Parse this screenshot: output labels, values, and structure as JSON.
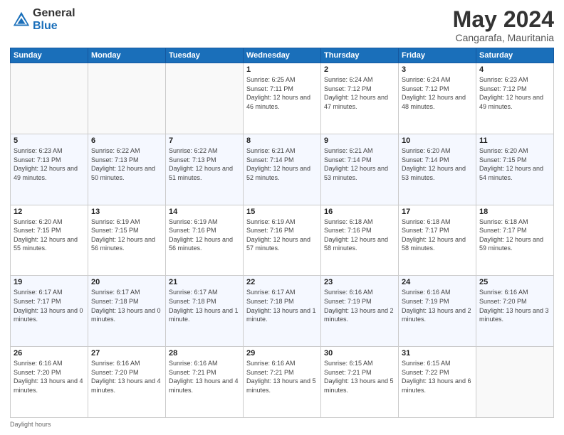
{
  "logo": {
    "general": "General",
    "blue": "Blue"
  },
  "title": "May 2024",
  "location": "Cangarafa, Mauritania",
  "headers": [
    "Sunday",
    "Monday",
    "Tuesday",
    "Wednesday",
    "Thursday",
    "Friday",
    "Saturday"
  ],
  "weeks": [
    [
      {
        "day": "",
        "sunrise": "",
        "sunset": "",
        "daylight": ""
      },
      {
        "day": "",
        "sunrise": "",
        "sunset": "",
        "daylight": ""
      },
      {
        "day": "",
        "sunrise": "",
        "sunset": "",
        "daylight": ""
      },
      {
        "day": "1",
        "sunrise": "Sunrise: 6:25 AM",
        "sunset": "Sunset: 7:11 PM",
        "daylight": "Daylight: 12 hours and 46 minutes."
      },
      {
        "day": "2",
        "sunrise": "Sunrise: 6:24 AM",
        "sunset": "Sunset: 7:12 PM",
        "daylight": "Daylight: 12 hours and 47 minutes."
      },
      {
        "day": "3",
        "sunrise": "Sunrise: 6:24 AM",
        "sunset": "Sunset: 7:12 PM",
        "daylight": "Daylight: 12 hours and 48 minutes."
      },
      {
        "day": "4",
        "sunrise": "Sunrise: 6:23 AM",
        "sunset": "Sunset: 7:12 PM",
        "daylight": "Daylight: 12 hours and 49 minutes."
      }
    ],
    [
      {
        "day": "5",
        "sunrise": "Sunrise: 6:23 AM",
        "sunset": "Sunset: 7:13 PM",
        "daylight": "Daylight: 12 hours and 49 minutes."
      },
      {
        "day": "6",
        "sunrise": "Sunrise: 6:22 AM",
        "sunset": "Sunset: 7:13 PM",
        "daylight": "Daylight: 12 hours and 50 minutes."
      },
      {
        "day": "7",
        "sunrise": "Sunrise: 6:22 AM",
        "sunset": "Sunset: 7:13 PM",
        "daylight": "Daylight: 12 hours and 51 minutes."
      },
      {
        "day": "8",
        "sunrise": "Sunrise: 6:21 AM",
        "sunset": "Sunset: 7:14 PM",
        "daylight": "Daylight: 12 hours and 52 minutes."
      },
      {
        "day": "9",
        "sunrise": "Sunrise: 6:21 AM",
        "sunset": "Sunset: 7:14 PM",
        "daylight": "Daylight: 12 hours and 53 minutes."
      },
      {
        "day": "10",
        "sunrise": "Sunrise: 6:20 AM",
        "sunset": "Sunset: 7:14 PM",
        "daylight": "Daylight: 12 hours and 53 minutes."
      },
      {
        "day": "11",
        "sunrise": "Sunrise: 6:20 AM",
        "sunset": "Sunset: 7:15 PM",
        "daylight": "Daylight: 12 hours and 54 minutes."
      }
    ],
    [
      {
        "day": "12",
        "sunrise": "Sunrise: 6:20 AM",
        "sunset": "Sunset: 7:15 PM",
        "daylight": "Daylight: 12 hours and 55 minutes."
      },
      {
        "day": "13",
        "sunrise": "Sunrise: 6:19 AM",
        "sunset": "Sunset: 7:15 PM",
        "daylight": "Daylight: 12 hours and 56 minutes."
      },
      {
        "day": "14",
        "sunrise": "Sunrise: 6:19 AM",
        "sunset": "Sunset: 7:16 PM",
        "daylight": "Daylight: 12 hours and 56 minutes."
      },
      {
        "day": "15",
        "sunrise": "Sunrise: 6:19 AM",
        "sunset": "Sunset: 7:16 PM",
        "daylight": "Daylight: 12 hours and 57 minutes."
      },
      {
        "day": "16",
        "sunrise": "Sunrise: 6:18 AM",
        "sunset": "Sunset: 7:16 PM",
        "daylight": "Daylight: 12 hours and 58 minutes."
      },
      {
        "day": "17",
        "sunrise": "Sunrise: 6:18 AM",
        "sunset": "Sunset: 7:17 PM",
        "daylight": "Daylight: 12 hours and 58 minutes."
      },
      {
        "day": "18",
        "sunrise": "Sunrise: 6:18 AM",
        "sunset": "Sunset: 7:17 PM",
        "daylight": "Daylight: 12 hours and 59 minutes."
      }
    ],
    [
      {
        "day": "19",
        "sunrise": "Sunrise: 6:17 AM",
        "sunset": "Sunset: 7:17 PM",
        "daylight": "Daylight: 13 hours and 0 minutes."
      },
      {
        "day": "20",
        "sunrise": "Sunrise: 6:17 AM",
        "sunset": "Sunset: 7:18 PM",
        "daylight": "Daylight: 13 hours and 0 minutes."
      },
      {
        "day": "21",
        "sunrise": "Sunrise: 6:17 AM",
        "sunset": "Sunset: 7:18 PM",
        "daylight": "Daylight: 13 hours and 1 minute."
      },
      {
        "day": "22",
        "sunrise": "Sunrise: 6:17 AM",
        "sunset": "Sunset: 7:18 PM",
        "daylight": "Daylight: 13 hours and 1 minute."
      },
      {
        "day": "23",
        "sunrise": "Sunrise: 6:16 AM",
        "sunset": "Sunset: 7:19 PM",
        "daylight": "Daylight: 13 hours and 2 minutes."
      },
      {
        "day": "24",
        "sunrise": "Sunrise: 6:16 AM",
        "sunset": "Sunset: 7:19 PM",
        "daylight": "Daylight: 13 hours and 2 minutes."
      },
      {
        "day": "25",
        "sunrise": "Sunrise: 6:16 AM",
        "sunset": "Sunset: 7:20 PM",
        "daylight": "Daylight: 13 hours and 3 minutes."
      }
    ],
    [
      {
        "day": "26",
        "sunrise": "Sunrise: 6:16 AM",
        "sunset": "Sunset: 7:20 PM",
        "daylight": "Daylight: 13 hours and 4 minutes."
      },
      {
        "day": "27",
        "sunrise": "Sunrise: 6:16 AM",
        "sunset": "Sunset: 7:20 PM",
        "daylight": "Daylight: 13 hours and 4 minutes."
      },
      {
        "day": "28",
        "sunrise": "Sunrise: 6:16 AM",
        "sunset": "Sunset: 7:21 PM",
        "daylight": "Daylight: 13 hours and 4 minutes."
      },
      {
        "day": "29",
        "sunrise": "Sunrise: 6:16 AM",
        "sunset": "Sunset: 7:21 PM",
        "daylight": "Daylight: 13 hours and 5 minutes."
      },
      {
        "day": "30",
        "sunrise": "Sunrise: 6:15 AM",
        "sunset": "Sunset: 7:21 PM",
        "daylight": "Daylight: 13 hours and 5 minutes."
      },
      {
        "day": "31",
        "sunrise": "Sunrise: 6:15 AM",
        "sunset": "Sunset: 7:22 PM",
        "daylight": "Daylight: 13 hours and 6 minutes."
      },
      {
        "day": "",
        "sunrise": "",
        "sunset": "",
        "daylight": ""
      }
    ]
  ],
  "footer": "Daylight hours"
}
